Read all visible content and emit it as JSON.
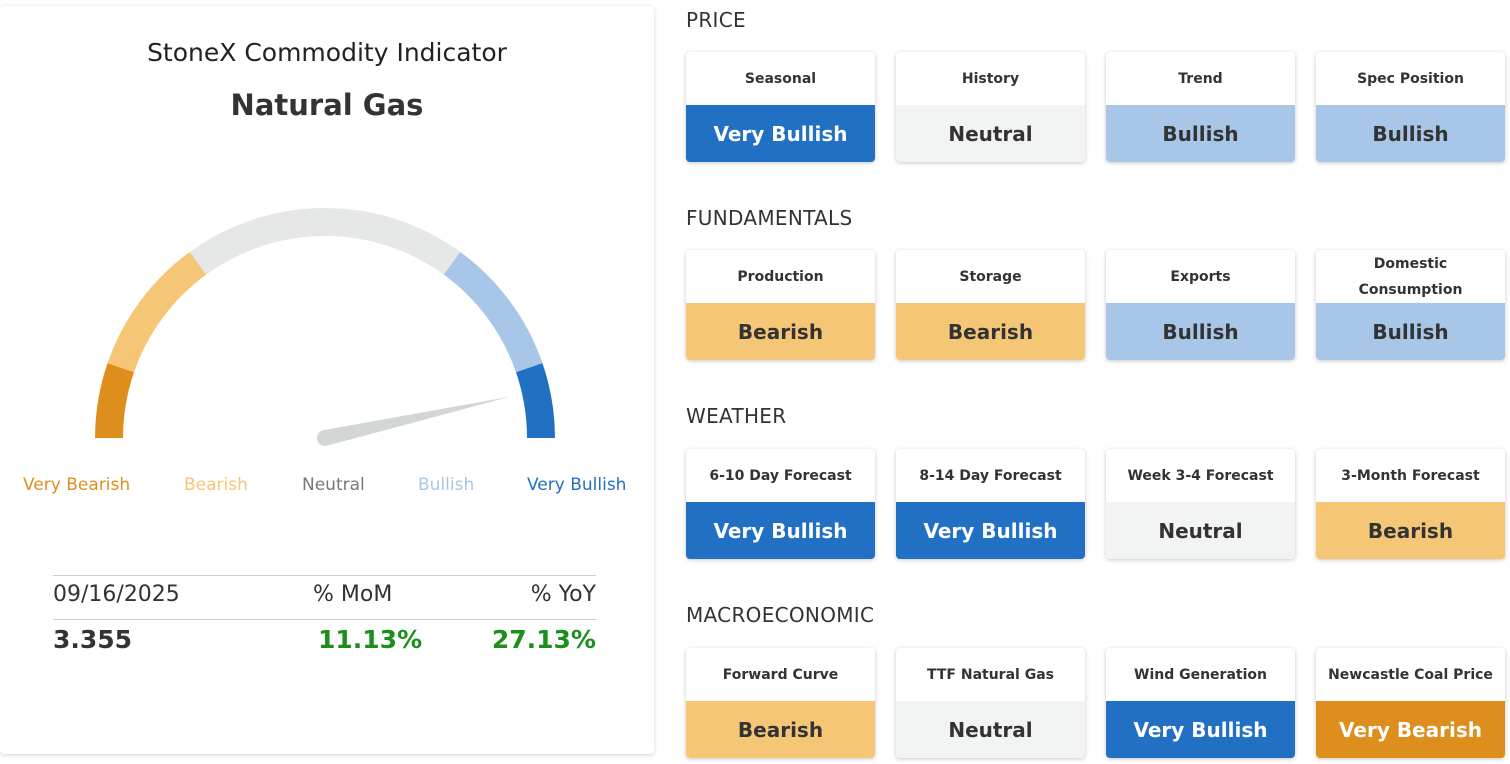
{
  "indicator": {
    "title": "StoneX Commodity Indicator",
    "commodity": "Natural Gas",
    "gauge": {
      "reading": 0.93,
      "labels": [
        "Very Bearish",
        "Bearish",
        "Neutral",
        "Bullish",
        "Very Bullish"
      ],
      "colors": {
        "very_bearish": "#dd8e1c",
        "bearish": "#f6c677",
        "neutral": "#e6e8e8",
        "bullish": "#a8c6e8",
        "very_bullish": "#2270c4",
        "needle": "#d2d6d6"
      }
    },
    "stats": {
      "headers": [
        "09/16/2025",
        "% MoM",
        "% YoY"
      ],
      "values": [
        "3.355",
        "11.13%",
        "27.13%"
      ]
    }
  },
  "sections": [
    {
      "label": "PRICE",
      "cards": [
        {
          "name": "Seasonal",
          "status": "Very Bullish"
        },
        {
          "name": "History",
          "status": "Neutral"
        },
        {
          "name": "Trend",
          "status": "Bullish"
        },
        {
          "name": "Spec Position",
          "status": "Bullish"
        }
      ]
    },
    {
      "label": "FUNDAMENTALS",
      "cards": [
        {
          "name": "Production",
          "status": "Bearish"
        },
        {
          "name": "Storage",
          "status": "Bearish"
        },
        {
          "name": "Exports",
          "status": "Bullish"
        },
        {
          "name": "Domestic Consumption",
          "status": "Bullish"
        }
      ]
    },
    {
      "label": "WEATHER",
      "cards": [
        {
          "name": "6-10 Day Forecast",
          "status": "Very Bullish"
        },
        {
          "name": "8-14 Day Forecast",
          "status": "Very Bullish"
        },
        {
          "name": "Week 3-4 Forecast",
          "status": "Neutral"
        },
        {
          "name": "3-Month Forecast",
          "status": "Bearish"
        }
      ]
    },
    {
      "label": "MACROECONOMIC",
      "cards": [
        {
          "name": "Forward Curve",
          "status": "Bearish"
        },
        {
          "name": "TTF Natural Gas",
          "status": "Neutral"
        },
        {
          "name": "Wind Generation",
          "status": "Very Bullish"
        },
        {
          "name": "Newcastle Coal Price",
          "status": "Very Bearish"
        }
      ]
    }
  ]
}
